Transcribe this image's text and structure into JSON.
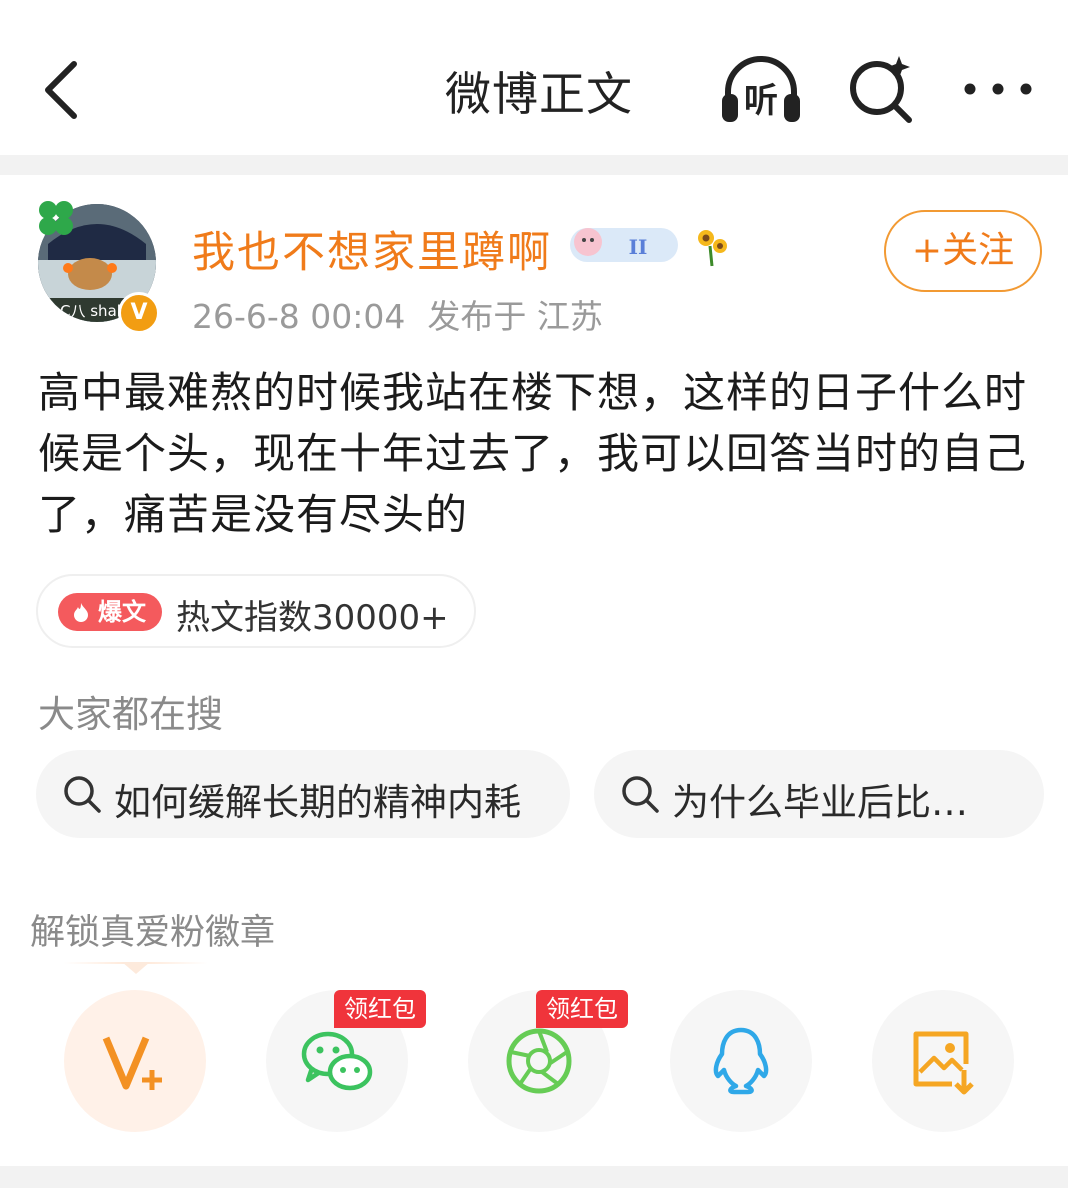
{
  "header": {
    "title": "微博正文",
    "listen_label": "听",
    "icons": {
      "back": "chevron-left-icon",
      "listen": "headphones-icon",
      "search": "search-sparkle-icon",
      "more": "more-dots-icon"
    }
  },
  "author": {
    "name": "我也不想家里蹲啊",
    "avatar_text": "C八 shak",
    "verified_mark": "V",
    "timestamp": "26-6-8 00:04",
    "location": "发布于 江苏",
    "follow_label": "+关注",
    "accent_color": "#f07b1a"
  },
  "post": {
    "text": "高中最难熬的时候我站在楼下想，这样的日子什么时候是个头，现在十年过去了，我可以回答当时的自己了，痛苦是没有尽头的"
  },
  "hot_tag": {
    "badge": "爆文",
    "text": "热文指数30000+",
    "badge_color": "#f45a5d"
  },
  "search_suggest": {
    "label": "大家都在搜",
    "items": [
      {
        "text": "如何缓解长期的精神内耗"
      },
      {
        "text": "为什么毕业后比…"
      }
    ]
  },
  "share": {
    "label": "解锁真爱粉徽章",
    "red_packet_label": "领红包",
    "items": [
      {
        "icon": "vplus-icon",
        "color": "#f39123"
      },
      {
        "icon": "wechat-icon",
        "color": "#3cc35f"
      },
      {
        "icon": "moments-icon",
        "color": "#66cc55"
      },
      {
        "icon": "qq-icon",
        "color": "#2fa8e8"
      },
      {
        "icon": "save-image-icon",
        "color": "#f5a623"
      }
    ]
  }
}
